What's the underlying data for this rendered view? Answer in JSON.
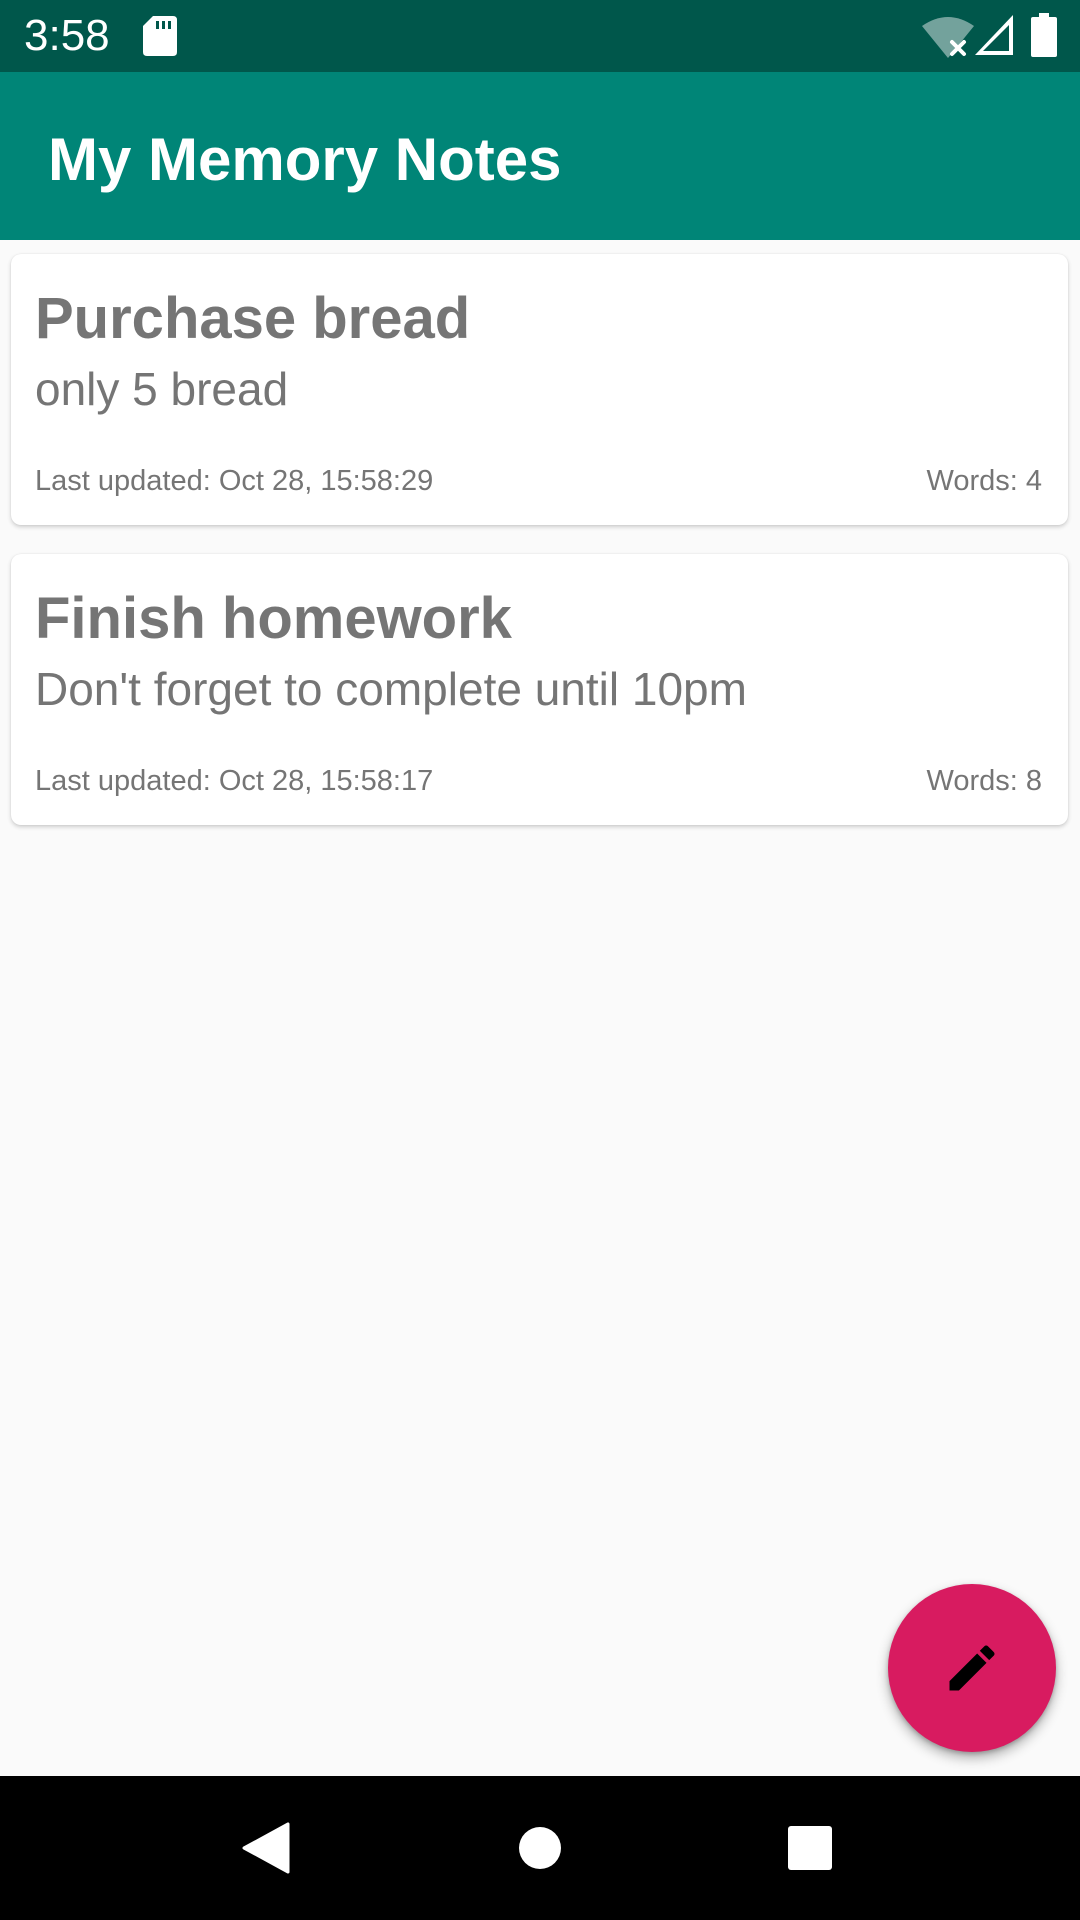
{
  "status_bar": {
    "time": "3:58",
    "icons": [
      "sd-card-icon",
      "wifi-off-icon",
      "cell-signal-icon",
      "battery-icon"
    ]
  },
  "app_bar": {
    "title": "My Memory Notes"
  },
  "notes": [
    {
      "title": "Purchase bread",
      "body": "only 5 bread",
      "last_updated": "Last updated: Oct 28, 15:58:29",
      "words": "Words: 4"
    },
    {
      "title": "Finish homework",
      "body": "Don't forget to complete until 10pm",
      "last_updated": "Last updated: Oct 28, 15:58:17",
      "words": "Words: 8"
    }
  ],
  "fab": {
    "icon": "pencil-icon"
  },
  "nav_bar": {
    "icons": [
      "back-icon",
      "home-icon",
      "recents-icon"
    ]
  },
  "colors": {
    "status_bar": "#00574b",
    "app_bar": "#008577",
    "accent": "#d81b60",
    "background": "#fafafa",
    "note_text": "#757575"
  }
}
